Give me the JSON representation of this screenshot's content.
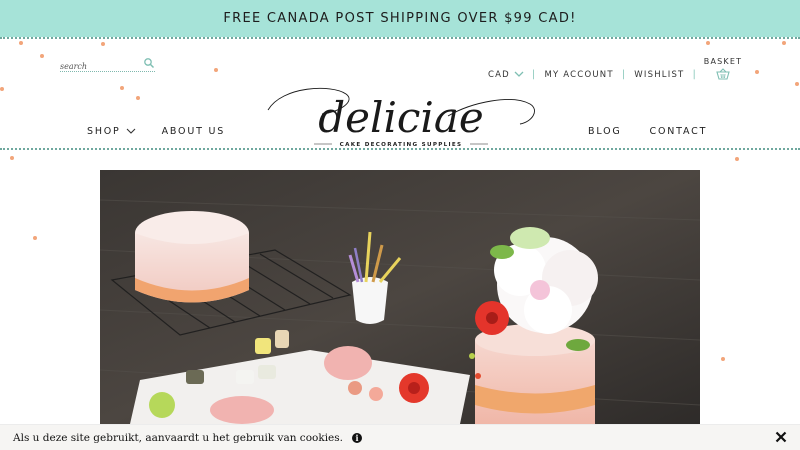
{
  "banner": {
    "text": "FREE CANADA POST SHIPPING OVER $99 CAD!"
  },
  "search": {
    "placeholder": "search",
    "icon": "search-icon"
  },
  "util_nav": {
    "currency": "CAD",
    "currency_icon": "chevron-down-icon",
    "my_account": "MY ACCOUNT",
    "wishlist": "WISHLIST",
    "separator": "|"
  },
  "basket": {
    "label": "BASKET",
    "icon": "basket-icon"
  },
  "logo": {
    "name": "deliciae",
    "tagline": "CAKE DECORATING SUPPLIES"
  },
  "main_nav": {
    "left": [
      {
        "label": "SHOP",
        "has_dropdown": true
      },
      {
        "label": "ABOUT US"
      }
    ],
    "right": [
      {
        "label": "BLOG"
      },
      {
        "label": "CONTACT"
      }
    ]
  },
  "hero": {
    "alt": "Decorated cakes with sugar flowers, paint pots and brushes on a wooden table"
  },
  "cookie_bar": {
    "text": "Als u deze site gebruikt, aanvaardt u het gebruik van cookies.",
    "info_icon": "i",
    "close_icon": "close-icon"
  },
  "colors": {
    "banner_bg": "#a6e3d8",
    "accent_teal": "#7fbfb3",
    "dot_peach": "#f2a57a",
    "cookie_bg": "#f6f5f3"
  }
}
